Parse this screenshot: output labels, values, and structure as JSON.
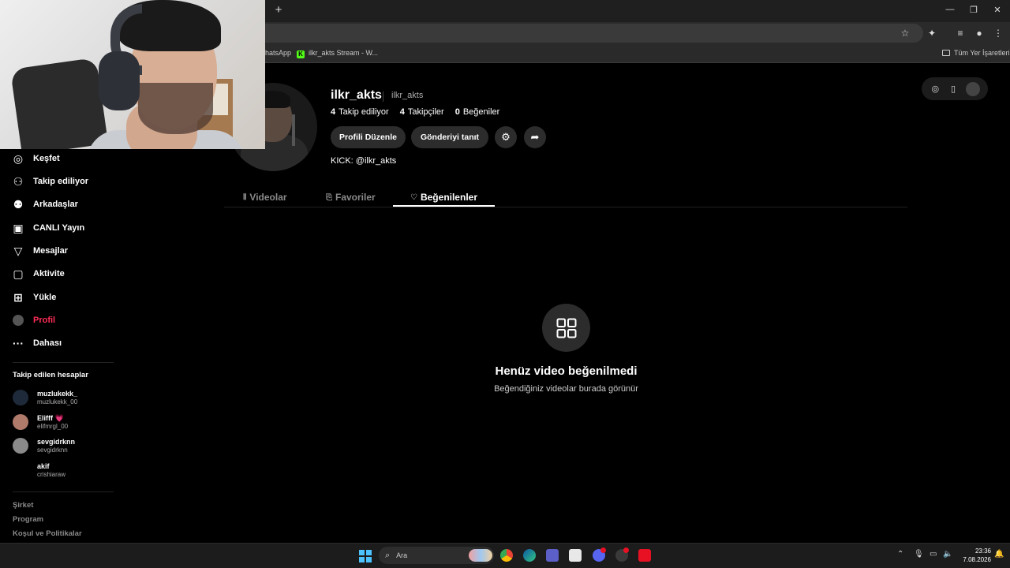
{
  "browser": {
    "new_tab": "+",
    "window_controls": [
      "—",
      "❐",
      "✕"
    ],
    "bookmarks": [
      {
        "label": "hatsApp"
      },
      {
        "label": "ilkr_akts Stream - W..."
      }
    ],
    "all_bookmarks": "Tüm Yer İşaretleri",
    "kick_logo": "K"
  },
  "sidebar": {
    "items": [
      {
        "label": "Keşfet",
        "icon": "compass-icon",
        "glyph": "◎"
      },
      {
        "label": "Takip ediliyor",
        "icon": "user-follow-icon",
        "glyph": "⚇"
      },
      {
        "label": "Arkadaşlar",
        "icon": "friends-icon",
        "glyph": "⚉"
      },
      {
        "label": "CANLI Yayın",
        "icon": "live-icon",
        "glyph": "▣"
      },
      {
        "label": "Mesajlar",
        "icon": "send-icon",
        "glyph": "▽"
      },
      {
        "label": "Aktivite",
        "icon": "activity-icon",
        "glyph": "▢"
      },
      {
        "label": "Yükle",
        "icon": "upload-icon",
        "glyph": "⊞"
      },
      {
        "label": "Profil",
        "icon": "profile-avatar-icon",
        "glyph": ""
      },
      {
        "label": "Dahası",
        "icon": "more-icon",
        "glyph": "···"
      }
    ],
    "following_heading": "Takip edilen hesaplar",
    "following": [
      {
        "name": "muzlukekk_",
        "handle": "muzlukekk_00",
        "avatar_color": "#1e2a3a"
      },
      {
        "name": "Elifff 💗",
        "handle": "elifmrgl_00",
        "avatar_color": "#b07a6a"
      },
      {
        "name": "sevgidrknn",
        "handle": "sevgidrknn",
        "avatar_color": "#8a8a8a"
      },
      {
        "name": "akif",
        "handle": "crishiaraw",
        "avatar_color": "#000000"
      }
    ],
    "footer": [
      "Şirket",
      "Program",
      "Koşul ve Politikalar"
    ]
  },
  "profile": {
    "username": "ilkr_akts",
    "nickname": "ilkr_akts",
    "stats": [
      {
        "value": "4",
        "label": "Takip ediliyor"
      },
      {
        "value": "4",
        "label": "Takipçiler"
      },
      {
        "value": "0",
        "label": "Beğeniler"
      }
    ],
    "edit_button": "Profili Düzenle",
    "promote_button": "Gönderiyi tanıt",
    "bio": "KICK: @ilkr_akts"
  },
  "tabs": [
    {
      "label": "Videolar",
      "icon": "grid-lines-icon",
      "glyph": "⦀"
    },
    {
      "label": "Favoriler",
      "icon": "bookmark-icon",
      "glyph": "⎘"
    },
    {
      "label": "Beğenilenler",
      "icon": "heart-icon",
      "glyph": "♡"
    }
  ],
  "empty_state": {
    "title": "Henüz video beğenilmedi",
    "subtitle": "Beğendiğiniz videolar burada görünür"
  },
  "taskbar": {
    "search_label": "Ara",
    "time": "23:36",
    "date": "7.08.2026"
  },
  "colors": {
    "accent": "#fe2c55",
    "background": "#000000",
    "button": "#2c2c2c"
  }
}
